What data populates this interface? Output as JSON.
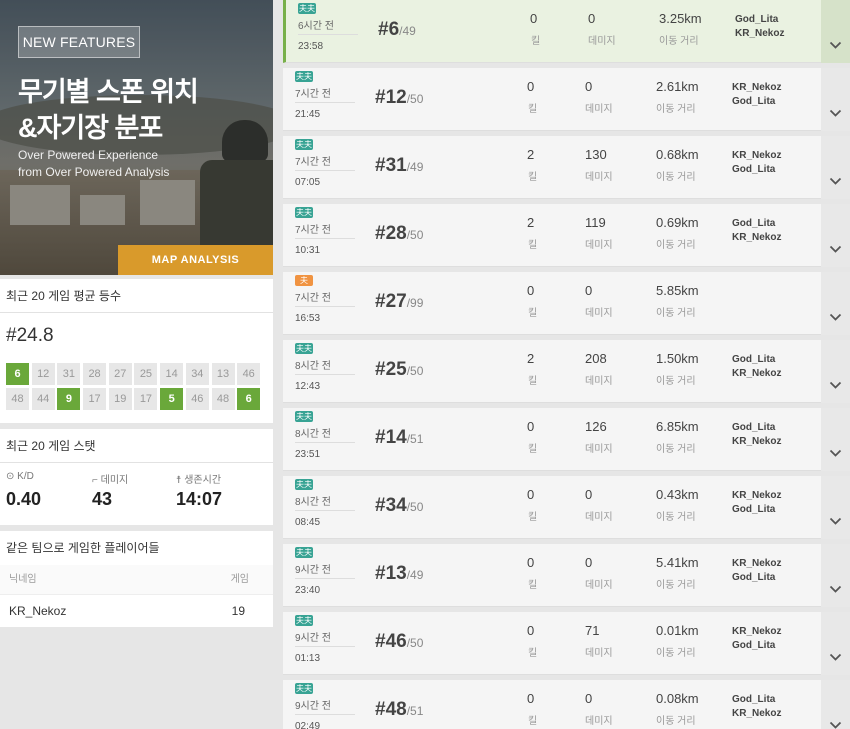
{
  "banner": {
    "badge": "NEW FEATURES",
    "title_line1": "무기별 스폰 위치",
    "title_line2": "&자기장 분포",
    "subtitle_line1": "Over Powered Experience",
    "subtitle_line2": "from Over Powered Analysis",
    "button": "MAP ANALYSIS"
  },
  "avg_rank": {
    "header": "최근 20 게임 평균 등수",
    "value": "#24.8",
    "cells": [
      {
        "rank": "6",
        "win": true
      },
      {
        "rank": "12",
        "win": false
      },
      {
        "rank": "31",
        "win": false
      },
      {
        "rank": "28",
        "win": false
      },
      {
        "rank": "27",
        "win": false
      },
      {
        "rank": "25",
        "win": false
      },
      {
        "rank": "14",
        "win": false
      },
      {
        "rank": "34",
        "win": false
      },
      {
        "rank": "13",
        "win": false
      },
      {
        "rank": "46",
        "win": false
      },
      {
        "rank": "48",
        "win": false
      },
      {
        "rank": "44",
        "win": false
      },
      {
        "rank": "9",
        "win": true
      },
      {
        "rank": "17",
        "win": false
      },
      {
        "rank": "19",
        "win": false
      },
      {
        "rank": "17",
        "win": false
      },
      {
        "rank": "5",
        "win": true
      },
      {
        "rank": "46",
        "win": false
      },
      {
        "rank": "48",
        "win": false
      },
      {
        "rank": "6",
        "win": true
      }
    ]
  },
  "stats": {
    "header": "최근 20 게임 스탯",
    "kd_label": "K/D",
    "kd_value": "0.40",
    "damage_label": "데미지",
    "damage_value": "43",
    "survival_label": "생존시간",
    "survival_value": "14:07"
  },
  "teammates": {
    "header": "같은 팀으로 게임한 플레이어들",
    "col_name": "닉네임",
    "col_games": "게임",
    "rows": [
      {
        "name": "KR_Nekoz",
        "games": "19"
      }
    ]
  },
  "labels": {
    "kills": "킬",
    "damage": "데미지",
    "distance": "이동 거리"
  },
  "matches": [
    {
      "mode": "夫夫",
      "ago": "6시간 전",
      "time": "23:58",
      "rank": "#6",
      "total": "/49",
      "kills": "0",
      "damage": "0",
      "distance": "3.25km",
      "players": [
        "God_Lita",
        "KR_Nekoz"
      ],
      "mode_color": "#38a394"
    },
    {
      "mode": "夫夫",
      "ago": "7시간 전",
      "time": "21:45",
      "rank": "#12",
      "total": "/50",
      "kills": "0",
      "damage": "0",
      "distance": "2.61km",
      "players": [
        "KR_Nekoz",
        "God_Lita"
      ],
      "mode_color": "#38a394"
    },
    {
      "mode": "夫夫",
      "ago": "7시간 전",
      "time": "07:05",
      "rank": "#31",
      "total": "/49",
      "kills": "2",
      "damage": "130",
      "distance": "0.68km",
      "players": [
        "KR_Nekoz",
        "God_Lita"
      ],
      "mode_color": "#38a394"
    },
    {
      "mode": "夫夫",
      "ago": "7시간 전",
      "time": "10:31",
      "rank": "#28",
      "total": "/50",
      "kills": "2",
      "damage": "119",
      "distance": "0.69km",
      "players": [
        "God_Lita",
        "KR_Nekoz"
      ],
      "mode_color": "#38a394"
    },
    {
      "mode": "夫",
      "ago": "7시간 전",
      "time": "16:53",
      "rank": "#27",
      "total": "/99",
      "kills": "0",
      "damage": "0",
      "distance": "5.85km",
      "players": [],
      "mode_color": "#f09341"
    },
    {
      "mode": "夫夫",
      "ago": "8시간 전",
      "time": "12:43",
      "rank": "#25",
      "total": "/50",
      "kills": "2",
      "damage": "208",
      "distance": "1.50km",
      "players": [
        "God_Lita",
        "KR_Nekoz"
      ],
      "mode_color": "#38a394"
    },
    {
      "mode": "夫夫",
      "ago": "8시간 전",
      "time": "23:51",
      "rank": "#14",
      "total": "/51",
      "kills": "0",
      "damage": "126",
      "distance": "6.85km",
      "players": [
        "God_Lita",
        "KR_Nekoz"
      ],
      "mode_color": "#38a394"
    },
    {
      "mode": "夫夫",
      "ago": "8시간 전",
      "time": "08:45",
      "rank": "#34",
      "total": "/50",
      "kills": "0",
      "damage": "0",
      "distance": "0.43km",
      "players": [
        "KR_Nekoz",
        "God_Lita"
      ],
      "mode_color": "#38a394"
    },
    {
      "mode": "夫夫",
      "ago": "9시간 전",
      "time": "23:40",
      "rank": "#13",
      "total": "/49",
      "kills": "0",
      "damage": "0",
      "distance": "5.41km",
      "players": [
        "KR_Nekoz",
        "God_Lita"
      ],
      "mode_color": "#38a394"
    },
    {
      "mode": "夫夫",
      "ago": "9시간 전",
      "time": "01:13",
      "rank": "#46",
      "total": "/50",
      "kills": "0",
      "damage": "71",
      "distance": "0.01km",
      "players": [
        "KR_Nekoz",
        "God_Lita"
      ],
      "mode_color": "#38a394"
    },
    {
      "mode": "夫夫",
      "ago": "9시간 전",
      "time": "02:49",
      "rank": "#48",
      "total": "/51",
      "kills": "0",
      "damage": "0",
      "distance": "0.08km",
      "players": [
        "God_Lita",
        "KR_Nekoz"
      ],
      "mode_color": "#38a394"
    }
  ]
}
